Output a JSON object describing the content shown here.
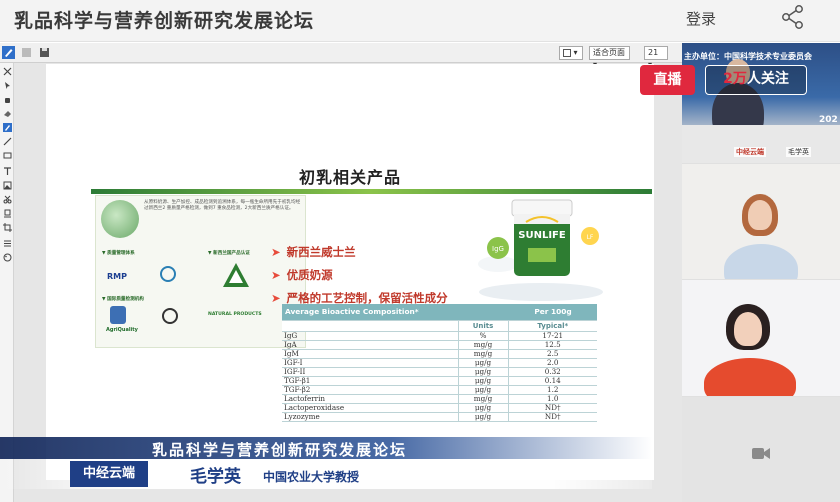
{
  "header": {
    "title": "乳品科学与营养创新研究发展论坛",
    "login_label": "登录",
    "share_icon": "share-icon"
  },
  "viewer": {
    "page_mode": "适合页面",
    "zoom": "21",
    "toolbar_icons": [
      "pen-icon",
      "save-icon",
      "disk-icon"
    ],
    "side_icons": [
      "close-icon",
      "pointer-icon",
      "hand-icon",
      "eraser-icon",
      "pen-icon",
      "line-icon",
      "rect-icon",
      "text-icon",
      "image-icon",
      "scissors-icon",
      "stamp-icon",
      "crop-icon",
      "list-icon",
      "palette-icon"
    ]
  },
  "slide": {
    "title": "初乳相关产品",
    "bullets": [
      "新西兰威士兰",
      "优质奶源",
      "严格的工艺控制，保留活性成分"
    ],
    "brochure": {
      "intro": "从原料奶源、生产加控、成品检测到追溯体系，每一瓶生命所用先于初乳均经过新西兰2 重质量严格检测，做到7 重食品检测，2大新西兰质严格认证。",
      "headings": [
        "▼ 质量管理体系",
        "▼ 新西兰国产品认证",
        "▼ 国际质量检测机构"
      ],
      "rmp": "RMP",
      "brand_mark": "AgriQuality",
      "natural_products": "NATURAL PRODUCTS"
    },
    "product": {
      "brand": "SUNLIFE",
      "badge1": "IgG",
      "badge2": "LF"
    },
    "table": {
      "header_left": "Average Bioactive Composition*",
      "header_right": "Per 100g",
      "col_units": "Units",
      "col_typical": "Typical*",
      "rows": [
        {
          "name": "IgG",
          "unit": "%",
          "value": "17-21"
        },
        {
          "name": "IgA",
          "unit": "mg/g",
          "value": "12.5"
        },
        {
          "name": "IgM",
          "unit": "mg/g",
          "value": "2.5"
        },
        {
          "name": "IGF-I",
          "unit": "μg/g",
          "value": "2.0"
        },
        {
          "name": "IGF-II",
          "unit": "μg/g",
          "value": "0.32"
        },
        {
          "name": "TGF-β1",
          "unit": "μg/g",
          "value": "0.14"
        },
        {
          "name": "TGF-β2",
          "unit": "μg/g",
          "value": "1.2"
        },
        {
          "name": "Lactoferrin",
          "unit": "mg/g",
          "value": "1.0"
        },
        {
          "name": "Lactoperoxidase",
          "unit": "μg/g",
          "value": "ND†"
        },
        {
          "name": "Lyzozyme",
          "unit": "μg/g",
          "value": "ND†"
        }
      ]
    }
  },
  "lower_third": {
    "forum": "乳品科学与营养创新研究发展论坛",
    "logo": "中经云端",
    "speaker_name": "毛学英",
    "speaker_role": "中国农业大学教授"
  },
  "badges": {
    "live_label": "直播",
    "follow_count": "2万",
    "follow_label": "人关注"
  },
  "cams": {
    "cam1_banner": "主办单位：中国科学技术专业委员会",
    "cam1_year": "202",
    "cam1_name_tag": "毛学英",
    "cam1_logo": "中经云端"
  },
  "colors": {
    "live_red": "#e0283e",
    "lower_third_blue": "#1f3f86",
    "slide_green": "#2c7b36",
    "table_header": "#7fb6bc"
  }
}
